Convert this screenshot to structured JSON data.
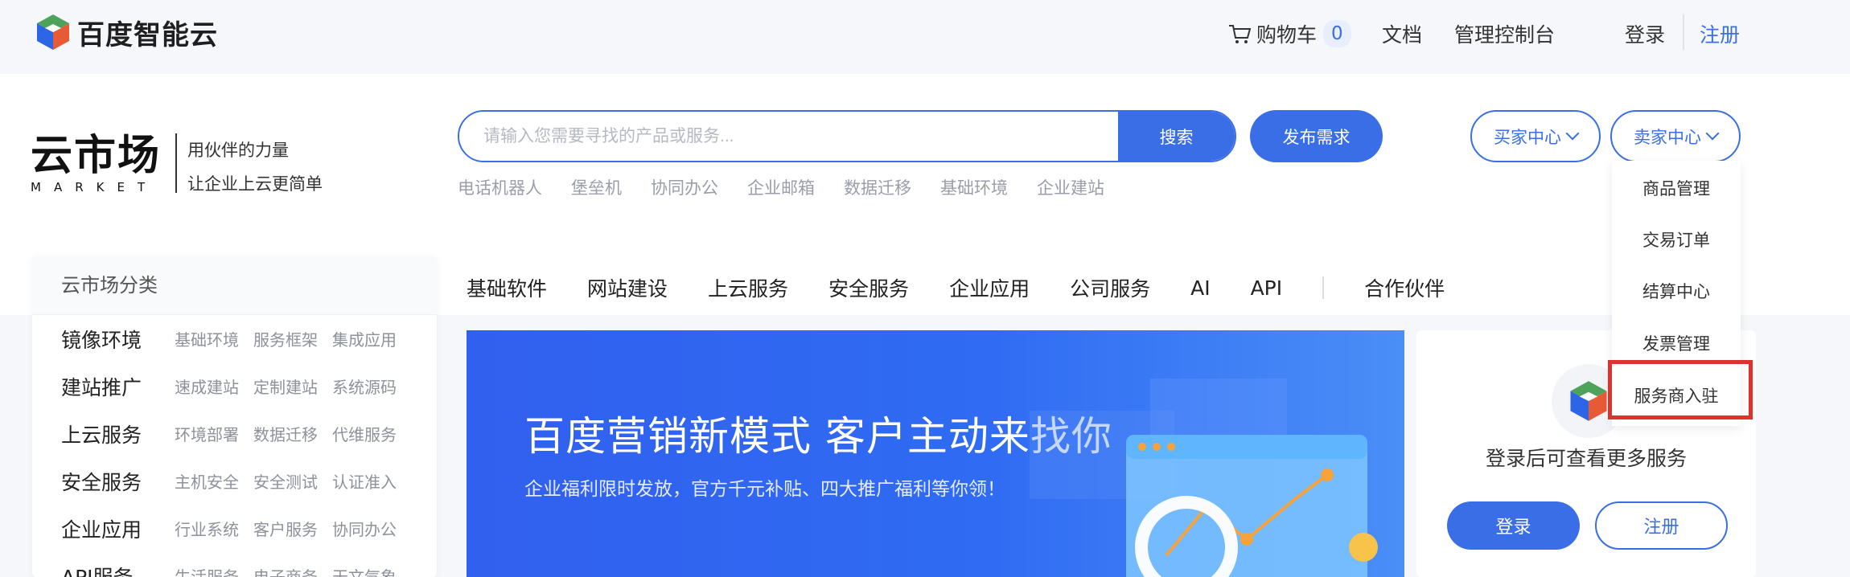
{
  "topbar": {
    "brand": "百度智能云",
    "cart_label": "购物车",
    "cart_count": "0",
    "docs": "文档",
    "console": "管理控制台",
    "login": "登录",
    "register": "注册"
  },
  "header": {
    "market_main": "云市场",
    "market_sub": "MARKET",
    "slogan_1": "用伙伴的力量",
    "slogan_2": "让企业上云更简单",
    "search_placeholder": "请输入您需要寻找的产品或服务...",
    "search_button": "搜索",
    "publish_button": "发布需求",
    "hot_tags": [
      "电话机器人",
      "堡垒机",
      "协同办公",
      "企业邮箱",
      "数据迁移",
      "基础环境",
      "企业建站"
    ],
    "buyer_center": "买家中心",
    "seller_center": "卖家中心"
  },
  "seller_menu": [
    "商品管理",
    "交易订单",
    "结算中心",
    "发票管理",
    "服务商入驻"
  ],
  "nav_tabs": [
    "基础软件",
    "网站建设",
    "上云服务",
    "安全服务",
    "企业应用",
    "公司服务",
    "AI",
    "API"
  ],
  "nav_partner": "合作伙伴",
  "category": {
    "title": "云市场分类",
    "rows": [
      {
        "name": "镜像环境",
        "subs": [
          "基础环境",
          "服务框架",
          "集成应用"
        ]
      },
      {
        "name": "建站推广",
        "subs": [
          "速成建站",
          "定制建站",
          "系统源码"
        ]
      },
      {
        "name": "上云服务",
        "subs": [
          "环境部署",
          "数据迁移",
          "代维服务"
        ]
      },
      {
        "name": "安全服务",
        "subs": [
          "主机安全",
          "安全测试",
          "认证准入"
        ]
      },
      {
        "name": "企业应用",
        "subs": [
          "行业系统",
          "客户服务",
          "协同办公"
        ]
      },
      {
        "name": "API服务",
        "subs": [
          "生活服务",
          "电子商务",
          "天文气象"
        ]
      }
    ]
  },
  "banner": {
    "title": "百度营销新模式 客户主动来找你",
    "subtitle": "企业福利限时发放，官方千元补贴、四大推广福利等你领！"
  },
  "login_card": {
    "tip": "登录后可查看更多服务",
    "login": "登录",
    "register": "注册"
  },
  "colors": {
    "accent": "#3a6ee6",
    "highlight": "#e03131"
  }
}
